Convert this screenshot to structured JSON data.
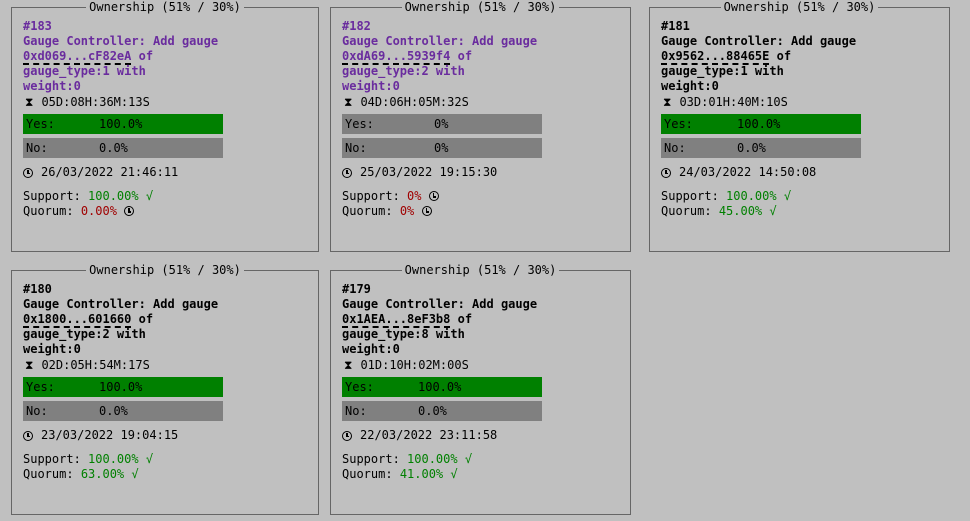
{
  "cards": [
    {
      "legend": "Ownership (51% / 30%)",
      "number": "#183",
      "title": "Gauge Controller: Add gauge",
      "address": "0xd069...cF82eA",
      "desc_rest_1": " of",
      "desc_line2": "gauge_type:1 with",
      "desc_line3": "weight:0",
      "timer": "05D:08H:36M:13S",
      "yes_label": "Yes:",
      "yes_pct": "100.0%",
      "yes_fraction": 1.0,
      "no_label": "No:",
      "no_pct": "0.0%",
      "no_fraction": 0.0,
      "date": "26/03/2022 21:46:11",
      "support_label": "Support:",
      "support_value": "100.00% √",
      "quorum_label": "Quorum:",
      "quorum_value": "0.00%"
    },
    {
      "legend": "Ownership (51% / 30%)",
      "number": "#182",
      "title": "Gauge Controller: Add gauge",
      "address": "0xdA69...5939f4",
      "desc_rest_1": " of",
      "desc_line2": "gauge_type:2 with",
      "desc_line3": "weight:0",
      "timer": "04D:06H:05M:32S",
      "yes_label": "Yes:",
      "yes_pct": "0%",
      "yes_fraction": 0.0,
      "no_label": "No:",
      "no_pct": "0%",
      "no_fraction": 0.0,
      "date": "25/03/2022 19:15:30",
      "support_label": "Support:",
      "support_value": "0%",
      "quorum_label": "Quorum:",
      "quorum_value": "0%"
    },
    {
      "legend": "Ownership (51% / 30%)",
      "number": "#181",
      "title": "Gauge Controller: Add gauge",
      "address": "0x9562...88465E",
      "desc_rest_1": " of",
      "desc_line2": "gauge_type:1 with",
      "desc_line3": "weight:0",
      "timer": "03D:01H:40M:10S",
      "yes_label": "Yes:",
      "yes_pct": "100.0%",
      "yes_fraction": 1.0,
      "no_label": "No:",
      "no_pct": "0.0%",
      "no_fraction": 0.0,
      "date": "24/03/2022 14:50:08",
      "support_label": "Support:",
      "support_value": "100.00% √",
      "quorum_label": "Quorum:",
      "quorum_value": "45.00% √"
    },
    {
      "legend": "Ownership (51% / 30%)",
      "number": "#180",
      "title": "Gauge Controller: Add gauge",
      "address": "0x1800...601660",
      "desc_rest_1": " of",
      "desc_line2": "gauge_type:2 with",
      "desc_line3": "weight:0",
      "timer": "02D:05H:54M:17S",
      "yes_label": "Yes:",
      "yes_pct": "100.0%",
      "yes_fraction": 1.0,
      "no_label": "No:",
      "no_pct": "0.0%",
      "no_fraction": 0.0,
      "date": "23/03/2022 19:04:15",
      "support_label": "Support:",
      "support_value": "100.00% √",
      "quorum_label": "Quorum:",
      "quorum_value": "63.00% √"
    },
    {
      "legend": "Ownership (51% / 30%)",
      "number": "#179",
      "title": "Gauge Controller: Add gauge",
      "address": "0x1AEA...8eF3b8",
      "desc_rest_1": " of",
      "desc_line2": "gauge_type:8 with",
      "desc_line3": "weight:0",
      "timer": "01D:10H:02M:00S",
      "yes_label": "Yes:",
      "yes_pct": "100.0%",
      "yes_fraction": 1.0,
      "no_label": "No:",
      "no_pct": "0.0%",
      "no_fraction": 0.0,
      "date": "22/03/2022 23:11:58",
      "support_label": "Support:",
      "support_value": "100.00% √",
      "quorum_label": "Quorum:",
      "quorum_value": "41.00% √"
    }
  ],
  "colors": {
    "background": "#c0c0c0",
    "yes_fill": "#008000",
    "bar_bg": "#808080",
    "pass": "#008000",
    "fail": "#a00000",
    "highlight_text": "#6a2c9e"
  },
  "icons": {
    "timer": "hourglass-icon",
    "date": "clock-icon",
    "pending": "clock-icon"
  }
}
